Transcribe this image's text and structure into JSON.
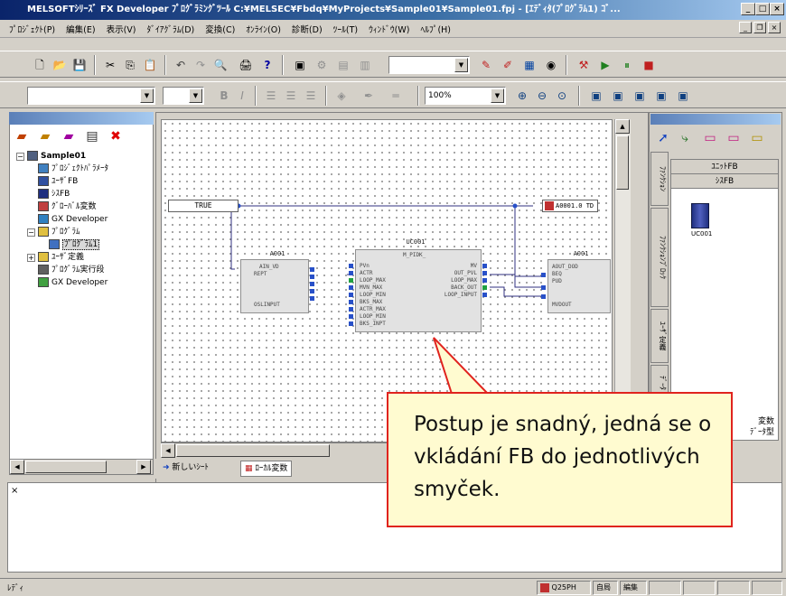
{
  "window": {
    "title": "MELSOFTｼﾘｰｽﾞ FX Developer ﾌﾟﾛｸﾞﾗﾐﾝｸﾞﾂｰﾙ C:¥MELSEC¥Fbdq¥MyProjects¥Sample01¥Sample01.fpj - [ｴﾃﾞｨﾀ(ﾌﾟﾛｸﾞﾗﾑ1) ｺﾞ...",
    "minimize": "_",
    "maximize": "□",
    "close": "×"
  },
  "menu": {
    "items": [
      "ﾌﾟﾛｼﾞｪｸﾄ(P)",
      "編集(E)",
      "表示(V)",
      "ﾀﾞｲｱｸﾞﾗﾑ(D)",
      "変換(C)",
      "ｵﾝﾗｲﾝ(O)",
      "診断(D)",
      "ﾂｰﾙ(T)",
      "ｳｨﾝﾄﾞｳ(W)",
      "ﾍﾙﾌﾟ(H)"
    ]
  },
  "toolbar": {
    "zoom_value": "100%"
  },
  "project": {
    "root": "Sample01",
    "items": [
      "ﾌﾟﾛｼﾞｪｸﾄﾊﾟﾗﾒｰﾀ",
      "ﾕｰｻﾞFB",
      "ｼｽFB",
      "ｸﾞﾛｰﾊﾞﾙ変数",
      "GX Developer",
      "ﾌﾟﾛｸﾞﾗﾑ",
      "ﾌﾟﾛｸﾞﾗﾑ1",
      "ﾕｰｻﾞ定義",
      "ﾌﾟﾛｸﾞﾗﾑ実行段",
      "GX Developer"
    ]
  },
  "diagram": {
    "constant": "TRUE",
    "blocks": {
      "left": {
        "name": "A001",
        "pins": [
          "AIN_VD",
          "REPT",
          "",
          "",
          "",
          "",
          "OSLINPUT"
        ]
      },
      "middle": {
        "name": "UC001",
        "type": "M_PIDK_",
        "pins_left": [
          "PVn",
          "ACTR",
          "LOOP_MAX",
          "MVN_MAX",
          "LOOP_MIN",
          "BKS_MAX",
          "ACTR_MAX",
          "LOOP_MIN",
          "BKS_INPT"
        ],
        "pins_right": [
          "MV",
          "OUT_PVL",
          "LOOP_MAX",
          "BACK_OUT",
          "LOOP_INPUT"
        ]
      },
      "right": {
        "name": "A001",
        "pins": [
          "AOUT_DOD",
          "BEQ",
          "PUD",
          "",
          "MVDOUT"
        ]
      }
    },
    "output_var": "A0001.0 TD"
  },
  "sheet_tabs": [
    "新しいｼｰﾄ",
    "ﾛｰｶﾙ変数"
  ],
  "palette": {
    "header_top": "ﾕﾆｯﾄFB",
    "header_sub": "ｼｽFB",
    "item_label": "UC001",
    "vertical_tabs": [
      "ﾌｧﾝｸｼｮﾝ",
      "ﾌｧﾝｸｼｮﾝﾌﾞﾛｯｸ",
      "ﾕｰｻﾞ定義",
      "ﾃﾞｰﾀ"
    ],
    "bottom_tabs": [
      "変数",
      "ﾃﾞｰﾀ型"
    ]
  },
  "status": {
    "left": "ﾚﾃﾞｨ",
    "cpu": "Q25PH",
    "mode1": "自局",
    "mode2": "編集"
  },
  "callout": {
    "text": "Postup je snadný, jedná se o vkládání FB do jednotlivých smyček."
  }
}
